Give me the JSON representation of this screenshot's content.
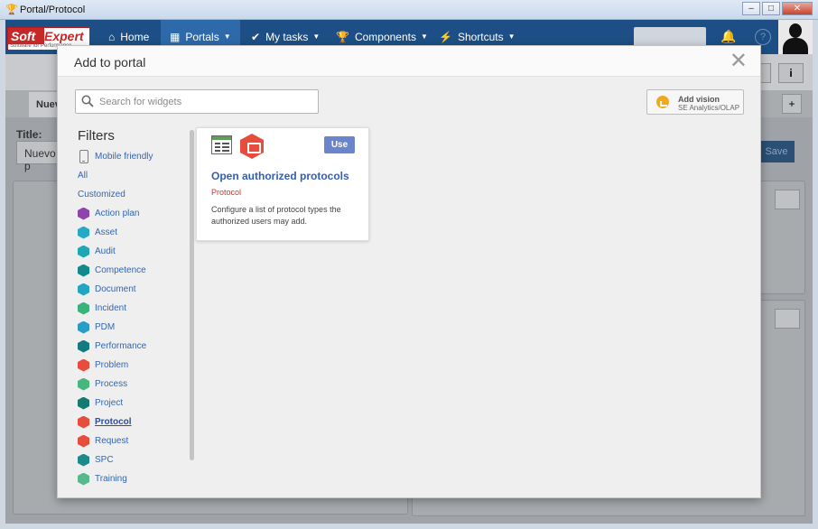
{
  "window": {
    "title": "Portal/Protocol"
  },
  "navbar": {
    "logo_soft": "Soft",
    "logo_expert": "Expert",
    "logo_tagline": "Software for Performance",
    "items": [
      {
        "label": "Home",
        "icon": "home-icon"
      },
      {
        "label": "Portals",
        "icon": "dashboard-icon",
        "active": true
      },
      {
        "label": "My tasks",
        "icon": "check-icon"
      },
      {
        "label": "Components",
        "icon": "trophy-icon"
      },
      {
        "label": "Shortcuts",
        "icon": "bolt-icon"
      }
    ]
  },
  "background_page": {
    "tab_label": "Nuev",
    "title_label": "Title:",
    "title_value": "Nuevo p",
    "save_label": "Save",
    "info_label": "i",
    "plus_label": "+"
  },
  "modal": {
    "title": "Add to portal",
    "close_label": "✕",
    "search": {
      "placeholder": "Search for widgets",
      "value": ""
    },
    "add_vision": {
      "title": "Add vision",
      "subtitle": "SE Analytics/OLAP"
    },
    "filters_title": "Filters",
    "filters": [
      {
        "label": "Mobile friendly",
        "icon": "mobile-icon",
        "color": ""
      },
      {
        "label": "All",
        "icon": "",
        "color": ""
      },
      {
        "label": "Customized",
        "icon": "",
        "color": ""
      },
      {
        "label": "Action plan",
        "icon": "action-plan-icon",
        "color": "#8e44ad"
      },
      {
        "label": "Asset",
        "icon": "asset-icon",
        "color": "#26a9c4"
      },
      {
        "label": "Audit",
        "icon": "audit-icon",
        "color": "#1fa8b3"
      },
      {
        "label": "Competence",
        "icon": "competence-icon",
        "color": "#118a8c"
      },
      {
        "label": "Document",
        "icon": "document-icon",
        "color": "#22a6c1"
      },
      {
        "label": "Incident",
        "icon": "incident-icon",
        "color": "#39b37a"
      },
      {
        "label": "PDM",
        "icon": "pdm-icon",
        "color": "#2a9cc8"
      },
      {
        "label": "Performance",
        "icon": "performance-icon",
        "color": "#137a82"
      },
      {
        "label": "Problem",
        "icon": "problem-icon",
        "color": "#e74c3c"
      },
      {
        "label": "Process",
        "icon": "process-icon",
        "color": "#48b77d"
      },
      {
        "label": "Project",
        "icon": "project-icon",
        "color": "#157a72"
      },
      {
        "label": "Protocol",
        "icon": "protocol-icon",
        "color": "#e74c3c",
        "selected": true
      },
      {
        "label": "Request",
        "icon": "request-icon",
        "color": "#e74c3c"
      },
      {
        "label": "SPC",
        "icon": "spc-icon",
        "color": "#1a8a8a"
      },
      {
        "label": "Training",
        "icon": "training-icon",
        "color": "#55b98b"
      }
    ],
    "widget": {
      "name": "Open authorized protocols",
      "category": "Protocol",
      "description": "Configure a list of protocol types the authorized users may add.",
      "use_label": "Use"
    }
  }
}
